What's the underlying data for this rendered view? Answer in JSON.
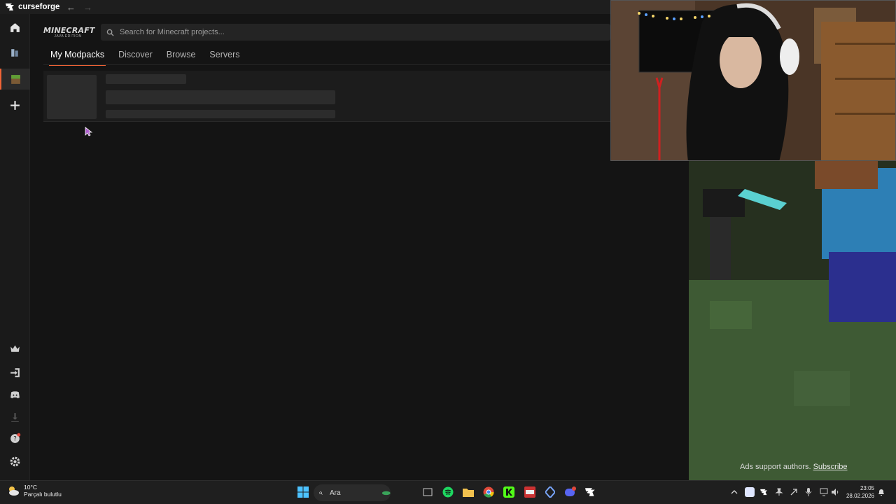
{
  "app": {
    "name": "curseforge"
  },
  "header": {
    "game_logo_line1": "MINECRAFT",
    "game_logo_line2": "JAVA EDITION",
    "search_placeholder": "Search for Minecraft projects..."
  },
  "tabs": [
    {
      "label": "My Modpacks",
      "active": true
    },
    {
      "label": "Discover",
      "active": false
    },
    {
      "label": "Browse",
      "active": false
    },
    {
      "label": "Servers",
      "active": false
    }
  ],
  "sidebar": {
    "top_icons": [
      "home-icon",
      "profiles-icon",
      "minecraft-grass-icon",
      "add-game-icon"
    ],
    "bottom_icons": [
      "premium-crown-icon",
      "login-icon",
      "discord-icon",
      "download-icon",
      "help-icon",
      "settings-icon"
    ]
  },
  "ads": {
    "text": "Ads support authors.",
    "link": "Subscribe"
  },
  "taskbar": {
    "weather_temp": "10°C",
    "weather_desc": "Parçalı bulutlu",
    "search_label": "Ara",
    "time": "23:05",
    "date": "28.02.2026"
  },
  "colors": {
    "accent": "#f16436",
    "background": "#141414",
    "sidebar": "#1a1a1a"
  }
}
